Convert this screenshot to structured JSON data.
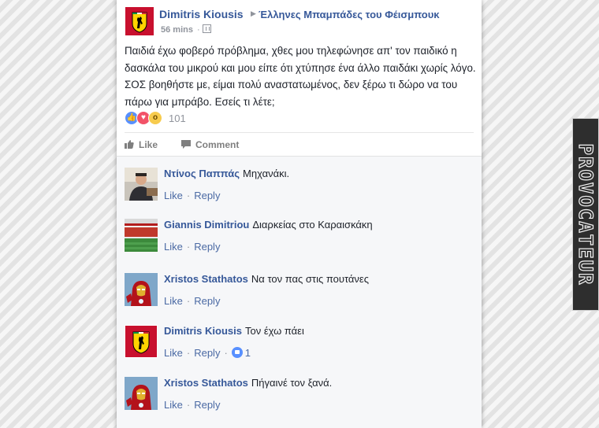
{
  "post": {
    "author": "Dimitris Kiousis",
    "group": "Έλληνες Μπαμπάδες του Φέισμπουκ",
    "time": "56 mins",
    "sep": "·",
    "text": "Παιδιά έχω φοβερό πρόβλημα, χθες μου τηλεφώνησε απ' τον παιδικό η δασκάλα του μικρού και μου είπε ότι χτύπησε ένα άλλο παιδάκι χωρίς λόγο. ΣΟΣ βοηθήστε με, είμαι πολύ αναστατωμένος, δεν ξέρω τι δώρο να του πάρω για μπράβο. Εσείς τι λέτε;",
    "reaction_count": "101",
    "reactions": [
      "like",
      "love",
      "wow"
    ]
  },
  "actions": {
    "like": "Like",
    "comment": "Comment"
  },
  "comments": [
    {
      "name": "Ντίνος Παππάς",
      "text": "Μηχανάκι.",
      "avatar": "photo-man",
      "like_label": "Like",
      "reply_label": "Reply",
      "likes": ""
    },
    {
      "name": "Giannis Dimitriou",
      "text": "Διαρκείας στο Καραισκάκη",
      "avatar": "stadium",
      "like_label": "Like",
      "reply_label": "Reply",
      "likes": ""
    },
    {
      "name": "Xristos Stathatos",
      "text": "Να τον πας στις πουτάνες",
      "avatar": "ironman",
      "like_label": "Like",
      "reply_label": "Reply",
      "likes": ""
    },
    {
      "name": "Dimitris Kiousis",
      "text": "Τον έχω πάει",
      "avatar": "ferrari",
      "like_label": "Like",
      "reply_label": "Reply",
      "likes": "1"
    },
    {
      "name": "Xristos Stathatos",
      "text": "Πήγαινέ τον ξανά.",
      "avatar": "ironman",
      "like_label": "Like",
      "reply_label": "Reply",
      "likes": ""
    }
  ],
  "watermark": "PROVOCATEUR",
  "colors": {
    "link": "#365899",
    "text": "#1d2129",
    "muted": "#90949c",
    "like_blue": "#5890ff"
  }
}
